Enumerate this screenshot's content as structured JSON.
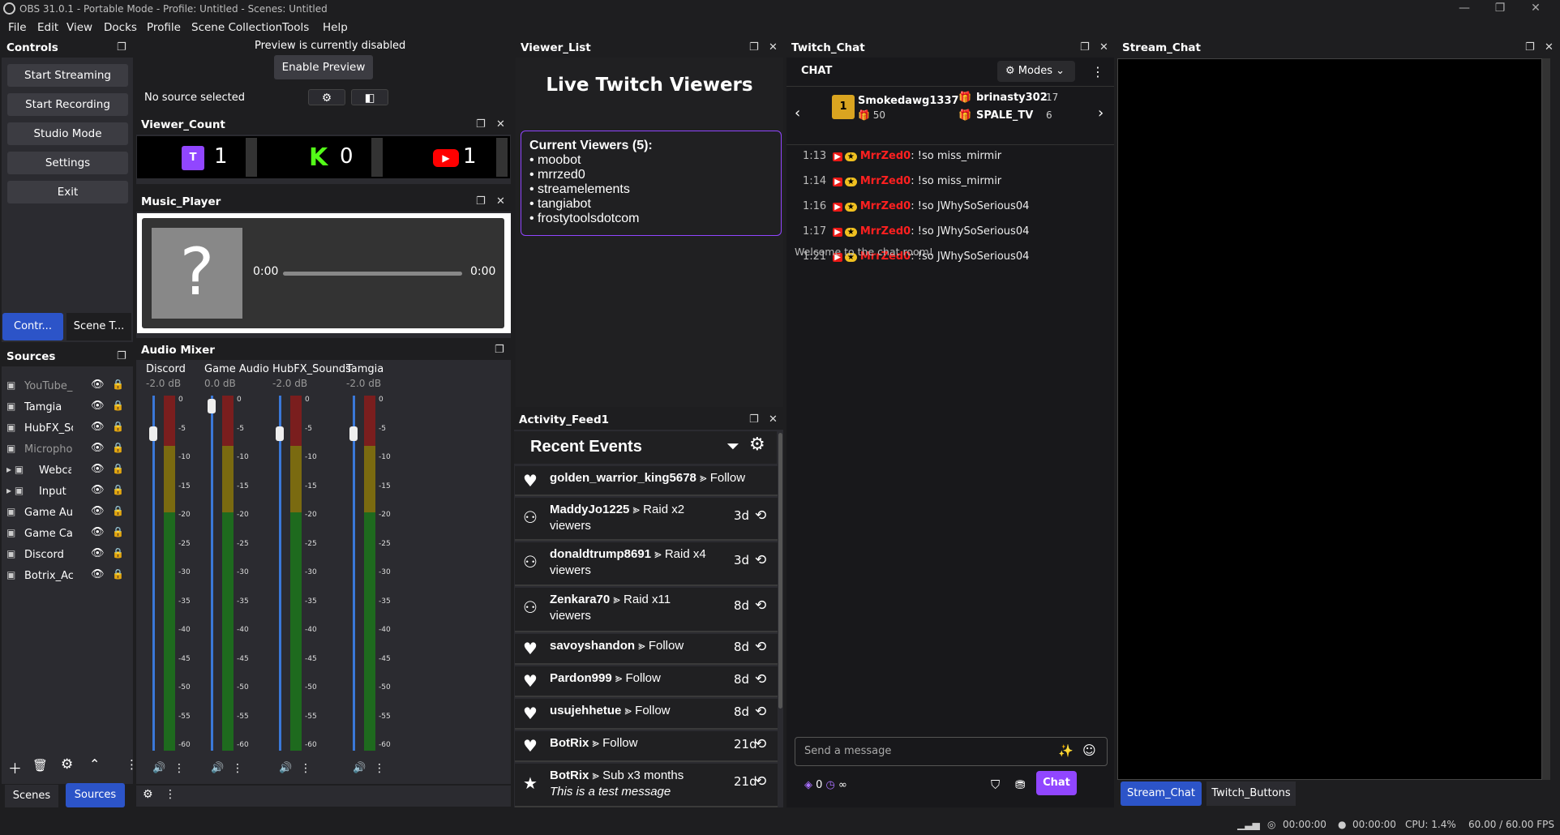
{
  "window": {
    "title": "OBS 31.0.1 - Portable Mode - Profile: Untitled - Scenes: Untitled",
    "min": "—",
    "max": "❐",
    "close": "✕"
  },
  "menu": [
    "File",
    "Edit",
    "View",
    "Docks",
    "Profile",
    "Scene Collection",
    "Tools",
    "Help"
  ],
  "controls": {
    "title": "Controls",
    "buttons": [
      "Start Streaming",
      "Start Recording",
      "Studio Mode",
      "Settings",
      "Exit"
    ],
    "tab_active": "Contr...",
    "tab_other": "Scene T..."
  },
  "preview": {
    "disabled_text": "Preview is currently disabled",
    "enable_btn": "Enable Preview",
    "no_source": "No source selected"
  },
  "viewer_count": {
    "title": "Viewer_Count",
    "twitch": "1",
    "kick": "0",
    "youtube": "1"
  },
  "music": {
    "title": "Music_Player",
    "time_left": "0:00",
    "time_right": "0:00"
  },
  "mixer": {
    "title": "Audio Mixer",
    "scale": [
      "0",
      "-5",
      "-10",
      "-15",
      "-20",
      "-25",
      "-30",
      "-35",
      "-40",
      "-45",
      "-50",
      "-55",
      "-60"
    ],
    "channels": [
      {
        "name": "Discord",
        "db": "-2.0 dB"
      },
      {
        "name": "Game Audio",
        "db": "0.0 dB"
      },
      {
        "name": "HubFX_Sounds",
        "db": "-2.0 dB"
      },
      {
        "name": "Tamgia",
        "db": "-2.0 dB"
      }
    ]
  },
  "sources": {
    "title": "Sources",
    "items": [
      "YouTube_Mu",
      "Tamgia",
      "HubFX_Soun",
      "Microphone",
      "Webcam",
      "Input",
      "Game Audio",
      "Game Captu",
      "Discord",
      "Botrix_Activi"
    ]
  },
  "bottom_tabs": {
    "scenes": "Scenes",
    "sources": "Sources"
  },
  "viewer_list": {
    "title": "Viewer_List",
    "heading": "Live Twitch Viewers",
    "current": "Current Viewers (5):",
    "viewers": [
      "• moobot",
      "• mrrzed0",
      "• streamelements",
      "• tangiabot",
      "• frostytoolsdotcom"
    ]
  },
  "activity": {
    "title": "Activity_Feed1",
    "heading": "Recent Events",
    "events": [
      {
        "name": "golden_warrior_king5678",
        "action": " ⪢ Follow",
        "time": "",
        "icon": "heart"
      },
      {
        "name": "MaddyJo1225",
        "action": " ⪢ Raid x2",
        "line2": "viewers",
        "time": "3d",
        "icon": "raid"
      },
      {
        "name": "donaldtrump8691",
        "action": " ⪢ Raid x4",
        "line2": "viewers",
        "time": "3d",
        "icon": "raid"
      },
      {
        "name": "Zenkara70",
        "action": " ⪢ Raid x11",
        "line2": "viewers",
        "time": "8d",
        "icon": "raid"
      },
      {
        "name": "savoyshandon",
        "action": " ⪢ Follow",
        "time": "8d",
        "icon": "heart"
      },
      {
        "name": "Pardon999",
        "action": " ⪢ Follow",
        "time": "8d",
        "icon": "heart"
      },
      {
        "name": "usujehhetue",
        "action": " ⪢ Follow",
        "time": "8d",
        "icon": "heart"
      },
      {
        "name": "BotRix",
        "action": " ⪢ Follow",
        "time": "21d",
        "icon": "heart"
      },
      {
        "name": "BotRix",
        "action": " ⪢ Sub x3 months",
        "line2": "This is a test message",
        "time": "21d",
        "icon": "star"
      }
    ]
  },
  "twitch_chat": {
    "title": "Twitch_Chat",
    "chat_label": "CHAT",
    "modes": "Modes",
    "leaders": [
      {
        "name": "Smokedawg1337",
        "count": "50"
      },
      {
        "name": "brinasty302",
        "count": "17"
      },
      {
        "name": "SPALE_TV",
        "count": "6"
      }
    ],
    "messages": [
      {
        "time": "1:13",
        "user": "MrrZed0",
        "text": ": !so miss_mirmir"
      },
      {
        "time": "1:14",
        "user": "MrrZed0",
        "text": ": !so miss_mirmir"
      },
      {
        "time": "1:16",
        "user": "MrrZed0",
        "text": ": !so JWhySoSerious04"
      },
      {
        "time": "1:17",
        "user": "MrrZed0",
        "text": ": !so JWhySoSerious04"
      },
      {
        "time": "1:21",
        "user": "MrrZed0",
        "text": ": !so JWhySoSerious04"
      }
    ],
    "welcome": "Welcome to the chat room!",
    "placeholder": "Send a message",
    "points": "0",
    "chat_btn": "Chat",
    "infinity": "∞"
  },
  "stream_chat": {
    "title": "Stream_Chat",
    "tab1": "Stream_Chat",
    "tab2": "Twitch_Buttons"
  },
  "status": {
    "rec1": "00:00:00",
    "rec2": "00:00:00",
    "cpu": "CPU: 1.4%",
    "fps": "60.00 / 60.00 FPS"
  },
  "colors": {
    "accent": "#2c54c8",
    "twitch": "#9146ff",
    "kick": "#53fc18",
    "youtube": "#ff0000",
    "user": "#ff2020"
  }
}
